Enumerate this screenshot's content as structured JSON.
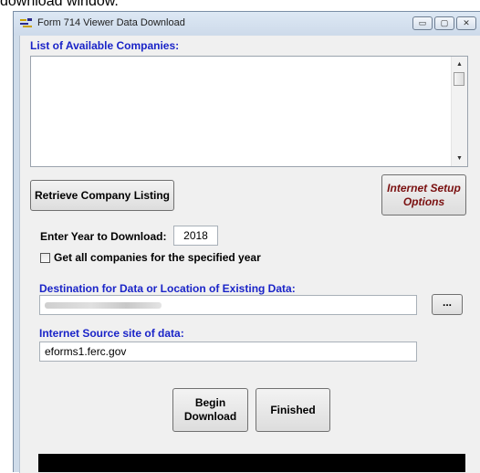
{
  "outer_caption": "download window.",
  "window": {
    "title": "Form 714 Viewer Data Download",
    "controls": {
      "minimize": "▭",
      "maximize": "▢",
      "close": "✕"
    }
  },
  "companies": {
    "label": "List of Available Companies:"
  },
  "buttons": {
    "retrieve": "Retrieve Company Listing",
    "internet_setup": "Internet Setup Options",
    "browse": "...",
    "begin_download": "Begin Download",
    "finished": "Finished"
  },
  "year": {
    "label": "Enter Year to Download:",
    "value": "2018"
  },
  "all_companies": {
    "label": "Get all companies for the specified year",
    "checked": false
  },
  "destination": {
    "label": "Destination for Data or Location of Existing Data:"
  },
  "source": {
    "label": "Internet Source site of data:",
    "value": "eforms1.ferc.gov"
  },
  "colors": {
    "label_blue": "#1a24c8",
    "internet_button_text": "#7a1010",
    "progress_bar": "#000000"
  },
  "icons": [
    "app-icon",
    "minimize-icon",
    "maximize-icon",
    "close-icon",
    "scroll-up-icon",
    "scroll-down-icon"
  ]
}
